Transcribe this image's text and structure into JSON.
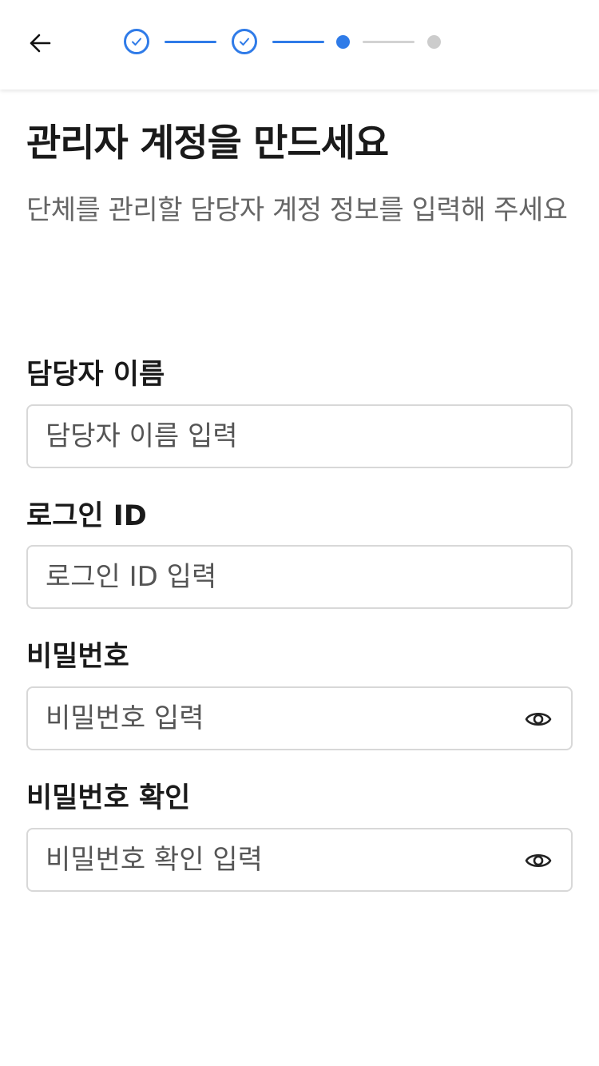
{
  "header": {
    "back_icon": "arrow-left-icon",
    "stepper": {
      "total_steps": 4,
      "completed_steps": 2,
      "current_step": 3,
      "accent_color": "#2f7be8",
      "inactive_color": "#cccccc"
    }
  },
  "main": {
    "title": "관리자 계정을 만드세요",
    "subtitle": "단체를 관리할 담당자 계정 정보를 입력해 주세요"
  },
  "form": {
    "name": {
      "label": "담당자 이름",
      "placeholder": "담당자 이름 입력",
      "value": ""
    },
    "login_id": {
      "label": "로그인 ID",
      "placeholder": "로그인 ID 입력",
      "value": ""
    },
    "password": {
      "label": "비밀번호",
      "placeholder": "비밀번호 입력",
      "value": "",
      "toggle_icon": "eye-icon"
    },
    "password_confirm": {
      "label": "비밀번호 확인",
      "placeholder": "비밀번호 확인 입력",
      "value": "",
      "toggle_icon": "eye-icon"
    }
  }
}
